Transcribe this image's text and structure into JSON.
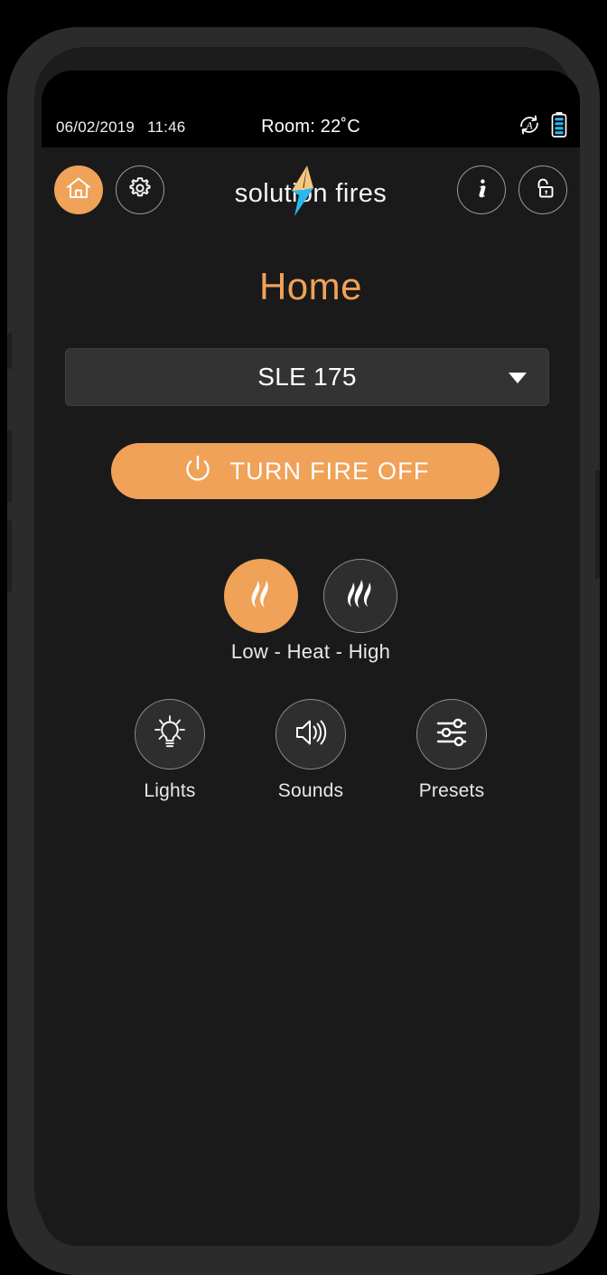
{
  "status_bar": {
    "date": "06/02/2019",
    "time": "11:46",
    "room_temperature": "Room: 22˚C",
    "auto_icon": "auto-refresh-icon",
    "battery_icon": "battery-icon"
  },
  "header": {
    "home_icon": "home-icon",
    "settings_icon": "gear-icon",
    "info_icon": "info-icon",
    "lock_icon": "unlocked-padlock-icon",
    "brand": "solution fires",
    "bolt_icon": "lightning-bolt-icon"
  },
  "page": {
    "title": "Home"
  },
  "model_selector": {
    "value": "SLE 175",
    "chevron_icon": "chevron-down-icon"
  },
  "power_button": {
    "label": "TURN FIRE OFF",
    "icon": "power-icon"
  },
  "heat": {
    "label": "Low - Heat - High",
    "levels": [
      {
        "name": "low",
        "icon": "flame-low-icon",
        "active": true
      },
      {
        "name": "high",
        "icon": "flame-high-icon",
        "active": false
      }
    ]
  },
  "features": [
    {
      "label": "Lights",
      "icon": "lightbulb-icon"
    },
    {
      "label": "Sounds",
      "icon": "speaker-icon"
    },
    {
      "label": "Presets",
      "icon": "sliders-icon"
    }
  ],
  "colors": {
    "accent_orange": "#efa258",
    "screen_background": "#1a1a1a",
    "status_bar_background": "#000000",
    "select_background": "#333333",
    "circle_background": "#2e2e2e",
    "bolt_top": "#f3c87f",
    "bolt_bottom": "#29b8ee",
    "battery_fill": "#29b8ee"
  }
}
